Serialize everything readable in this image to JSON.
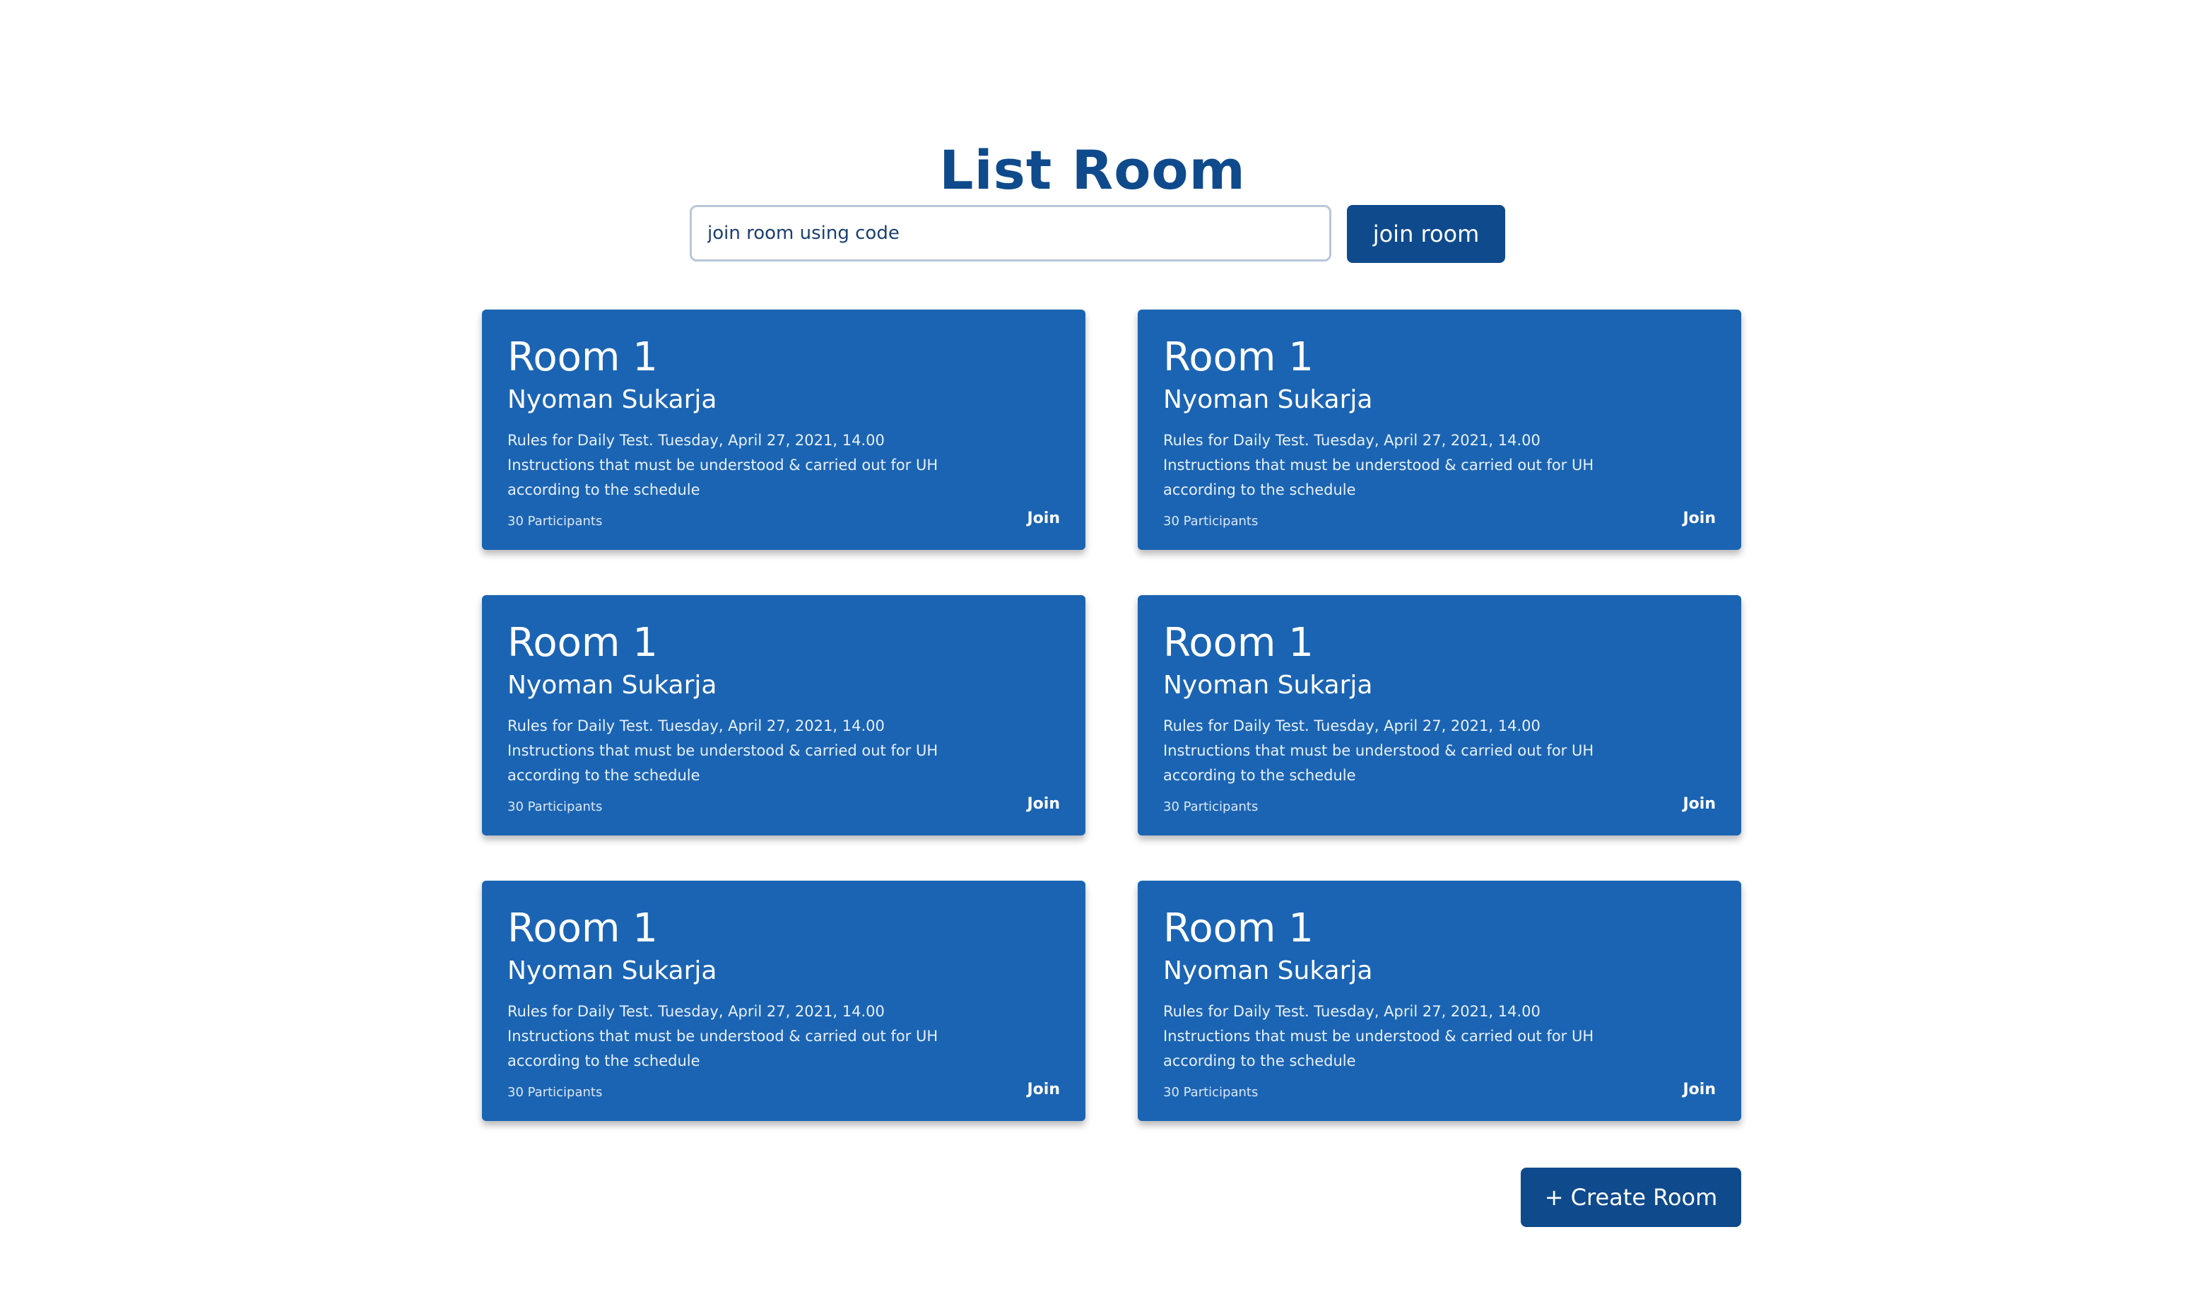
{
  "page": {
    "title": "List Room"
  },
  "join": {
    "placeholder": "join room using code",
    "button_label": "join room"
  },
  "rooms": [
    {
      "title": "Room 1",
      "owner": "Nyoman Sukarja",
      "description": "Rules for Daily Test. Tuesday, April 27, 2021, 14.00 Instructions that must be understood & carried out for UH according to the schedule",
      "participants": "30 Participants",
      "join_label": "Join"
    },
    {
      "title": "Room 1",
      "owner": "Nyoman Sukarja",
      "description": "Rules for Daily Test. Tuesday, April 27, 2021, 14.00 Instructions that must be understood & carried out for UH according to the schedule",
      "participants": "30 Participants",
      "join_label": "Join"
    },
    {
      "title": "Room 1",
      "owner": "Nyoman Sukarja",
      "description": "Rules for Daily Test. Tuesday, April 27, 2021, 14.00 Instructions that must be understood & carried out for UH according to the schedule",
      "participants": "30 Participants",
      "join_label": "Join"
    },
    {
      "title": "Room 1",
      "owner": "Nyoman Sukarja",
      "description": "Rules for Daily Test. Tuesday, April 27, 2021, 14.00 Instructions that must be understood & carried out for UH according to the schedule",
      "participants": "30 Participants",
      "join_label": "Join"
    },
    {
      "title": "Room 1",
      "owner": "Nyoman Sukarja",
      "description": "Rules for Daily Test. Tuesday, April 27, 2021, 14.00 Instructions that must be understood & carried out for UH according to the schedule",
      "participants": "30 Participants",
      "join_label": "Join"
    },
    {
      "title": "Room 1",
      "owner": "Nyoman Sukarja",
      "description": "Rules for Daily Test. Tuesday, April 27, 2021, 14.00 Instructions that must be understood & carried out for UH according to the schedule",
      "participants": "30 Participants",
      "join_label": "Join"
    }
  ],
  "actions": {
    "create_room_label": "+ Create Room"
  },
  "colors": {
    "brand_dark": "#0f4a8c",
    "card_blue": "#1b64b3",
    "background": "#ffffff"
  }
}
